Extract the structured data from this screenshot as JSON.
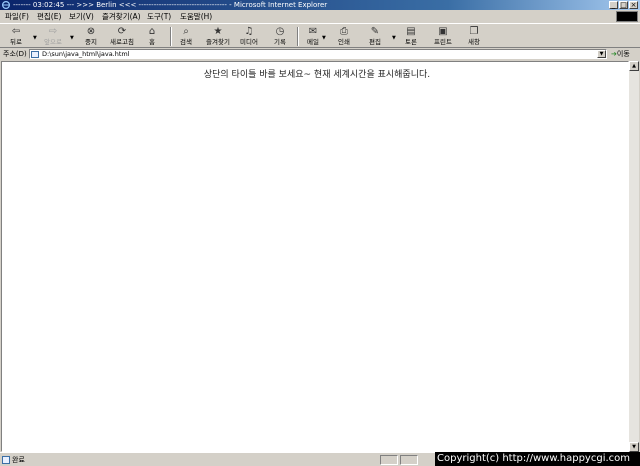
{
  "window": {
    "title": "------- 03:02:45 --- >>> Berlin <<< ----------------------------------- - Microsoft Internet Explorer",
    "controls": [
      "_",
      "□",
      "×"
    ]
  },
  "menu": [
    "파일(F)",
    "편집(E)",
    "보기(V)",
    "즐겨찾기(A)",
    "도구(T)",
    "도움말(H)"
  ],
  "toolbar": {
    "back": "뒤로",
    "forward": "앞으로",
    "stop": "중지",
    "refresh": "새로고침",
    "home": "홈",
    "search": "검색",
    "favorites": "즐겨찾기",
    "media": "미디어",
    "history": "기록",
    "mail": "메일",
    "print": "인쇄",
    "edit": "편집",
    "discuss": "토론",
    "printer": "프린트",
    "messenger": "새창"
  },
  "address": {
    "label": "주소(D)",
    "url": "D:\\sun\\java_html\\java.html",
    "go_label": "이동"
  },
  "content": {
    "message": "상단의 타이틀 바를 보세요~ 현재 세계시간을 표시해줍니다."
  },
  "status": {
    "text": "완료",
    "watermark": "Copyright(c) http://www.happycgi.com"
  }
}
